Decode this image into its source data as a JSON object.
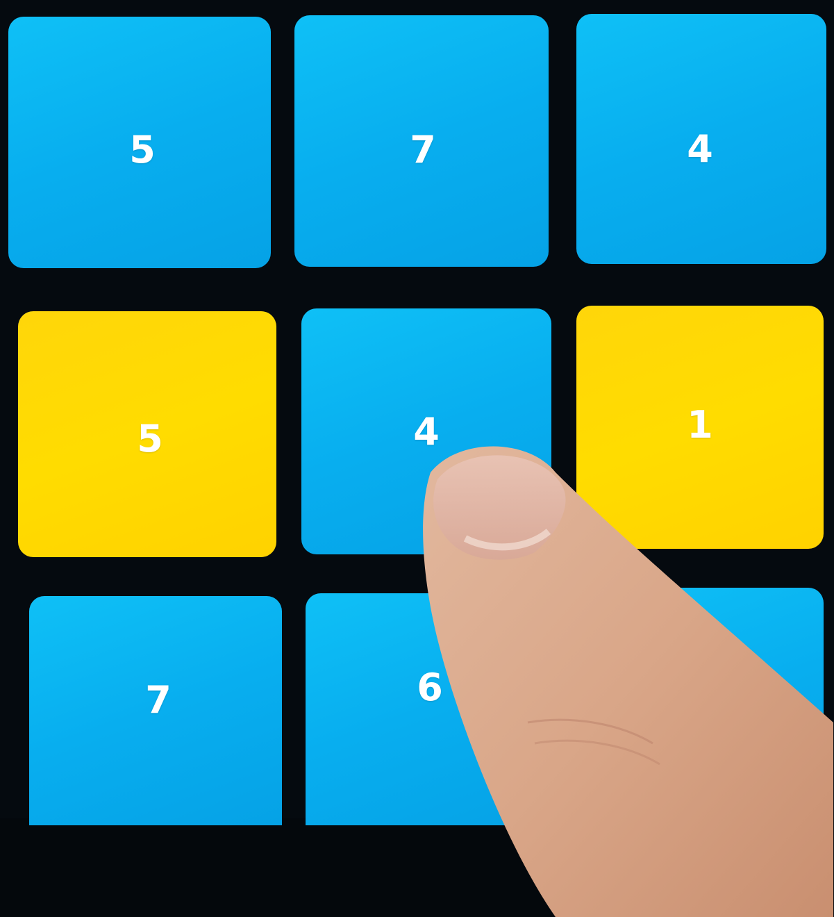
{
  "board": {
    "tiles": [
      {
        "value": "5",
        "color": "blue"
      },
      {
        "value": "7",
        "color": "blue"
      },
      {
        "value": "4",
        "color": "blue"
      },
      {
        "value": "5",
        "color": "yellow"
      },
      {
        "value": "4",
        "color": "blue"
      },
      {
        "value": "1",
        "color": "yellow"
      },
      {
        "value": "7",
        "color": "blue"
      },
      {
        "value": "6",
        "color": "blue"
      },
      {
        "value": "",
        "color": "blue"
      }
    ]
  },
  "colors": {
    "background": "#050a0f",
    "tile_blue": "#08aeef",
    "tile_yellow": "#ffdc00",
    "tile_text": "#ffffff"
  }
}
